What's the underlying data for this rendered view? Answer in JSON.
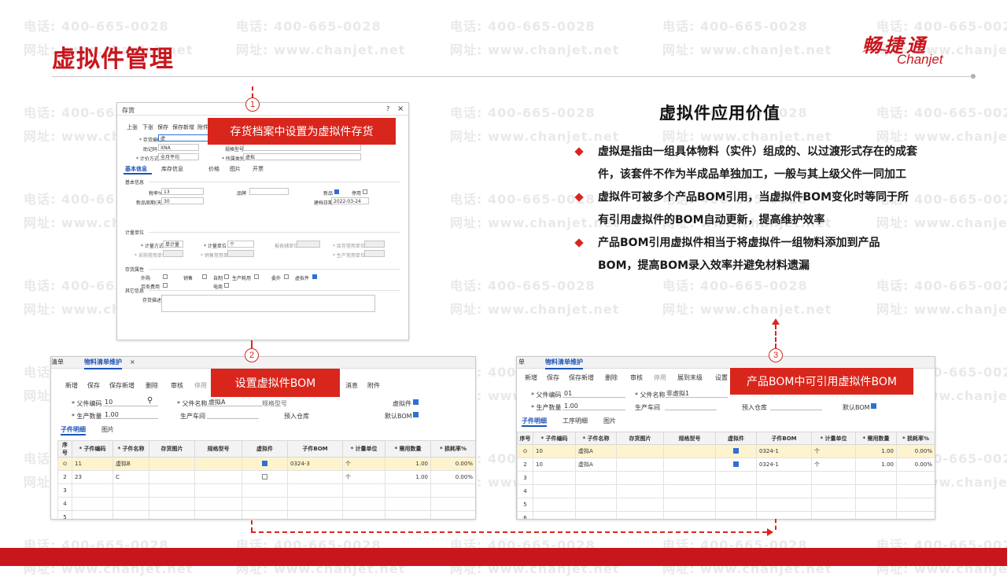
{
  "slide": {
    "title": "虚拟件管理",
    "logo_cn": "畅捷通",
    "logo_en": "Chanjet",
    "watermark_phone": "电话: 400-665-0028",
    "watermark_site": "网址: www.chanjet.net",
    "accent_color": "#c8161d"
  },
  "callouts": {
    "c1": {
      "num": "1",
      "text": "存货档案中设置为虚拟件存货"
    },
    "c2": {
      "num": "2",
      "text": "设置虚拟件BOM"
    },
    "c3": {
      "num": "3",
      "text": "产品BOM中可引用虚拟件BOM"
    }
  },
  "value": {
    "title": "虚拟件应用价值",
    "bullets": [
      "虚拟是指由一组具体物料（实件）组成的、以过渡形式存在的成套件，该套件不作为半成品单独加工，一般与其上级父件一同加工",
      "虚拟件可被多个产品BOM引用，当虚拟件BOM变化时等同于所有引用虚拟件的BOM自动更新，提高维护效率",
      "产品BOM引用虚拟件相当于将虚拟件一组物料添加到产品BOM，提高BOM录入效率并避免材料遗漏"
    ]
  },
  "inventory": {
    "title": "存货",
    "toolbar": [
      "上张",
      "下张",
      "保存",
      "保存新增",
      "附件"
    ],
    "fields": {
      "code_label": "* 存货编码",
      "code_value": "虚",
      "mnemonic_label": "助记码",
      "mnemonic_value": "XNA",
      "spec_label": "规格型号",
      "cost_label": "* 计价方式",
      "cost_value": "全月平均",
      "category_label": "* 所属类别",
      "category_value": "虚拟"
    },
    "tabs": [
      "基本信息",
      "库存信息",
      "价格",
      "图片",
      "开票"
    ],
    "basic": {
      "section": "基本信息",
      "tax_label": "税率%",
      "tax_value": "13",
      "brand_label": "品牌",
      "new_label": "新品",
      "disabled_label": "停用",
      "cycle_label": "新品周期(天)",
      "cycle_value": "30",
      "created_label": "建档日期",
      "created_value": "2022-03-24"
    },
    "unit": {
      "section": "计量单位",
      "method_label": "* 计量方式",
      "method_value": "单计量",
      "unit_label": "* 计量单位",
      "unit_value": "个",
      "report_label": "报表辅单位",
      "stock_label": "* 库存常用单位",
      "purchase_label": "* 采购常用单位",
      "sale_label": "* 销售常用单位",
      "prod_label": "* 生产常用单位"
    },
    "attr": {
      "section": "存货属性",
      "items": [
        "外购",
        "销售",
        "自制",
        "生产耗用",
        "委外",
        "虚拟件",
        "劳务费用",
        "电商"
      ]
    },
    "other": {
      "section": "其它信息",
      "desc_label": "存货描述"
    }
  },
  "bom_left": {
    "tab_prev": "清单",
    "tab": "物料清单维护",
    "toolbar": [
      "新增",
      "保存",
      "保存新增",
      "删除",
      "审核",
      "停用",
      "消息",
      "附件"
    ],
    "parent_code_label": "* 父件编码",
    "parent_code_value": "10",
    "parent_name_label": "* 父件名称",
    "parent_name_value": "虚拟A",
    "spec_label": "规格型号",
    "virtual_label": "虚拟件",
    "qty_label": "* 生产数量",
    "qty_value": "1.00",
    "workshop_label": "生产车间",
    "warehouse_label": "预入仓库",
    "default_label": "默认BOM",
    "subtabs": [
      "子件明细",
      "图片"
    ],
    "columns": [
      "序号",
      "* 子件编码",
      "* 子件名称",
      "存货图片",
      "规格型号",
      "虚拟件",
      "子件BOM",
      "* 计量单位",
      "* 需用数量",
      "* 损耗率%"
    ],
    "rows": [
      {
        "seq": "",
        "code": "11",
        "name": "虚拟B",
        "virtual": true,
        "bom": "0324-3",
        "unit": "个",
        "qty": "1.00",
        "loss": "0.00%"
      },
      {
        "seq": "2",
        "code": "23",
        "name": "C",
        "virtual": false,
        "bom": "",
        "unit": "个",
        "qty": "1.00",
        "loss": "0.00%"
      }
    ]
  },
  "bom_right": {
    "tab_prev": "单",
    "tab": "物料清单维护",
    "toolbar": [
      "新增",
      "保存",
      "保存新增",
      "删除",
      "审核",
      "停用",
      "展到末级",
      "设置"
    ],
    "parent_code_label": "* 父件编码",
    "parent_code_value": "01",
    "parent_name_label": "* 父件名称",
    "parent_name_value": "非虚拟1",
    "qty_label": "* 生产数量",
    "qty_value": "1.00",
    "workshop_label": "生产车间",
    "warehouse_label": "预入仓库",
    "default_label": "默认BOM",
    "subtabs": [
      "子件明细",
      "工序明细",
      "图片"
    ],
    "columns": [
      "序号",
      "* 子件编码",
      "* 子件名称",
      "存货图片",
      "规格型号",
      "虚拟件",
      "子件BOM",
      "* 计量单位",
      "* 需用数量",
      "* 损耗率%"
    ],
    "rows": [
      {
        "seq": "",
        "code": "10",
        "name": "虚拟A",
        "virtual": true,
        "bom": "0324-1",
        "unit": "个",
        "qty": "1.00",
        "loss": "0.00%"
      },
      {
        "seq": "2",
        "code": "10",
        "name": "虚拟A",
        "virtual": true,
        "bom": "0324-1",
        "unit": "个",
        "qty": "1.00",
        "loss": "0.00%"
      }
    ]
  }
}
